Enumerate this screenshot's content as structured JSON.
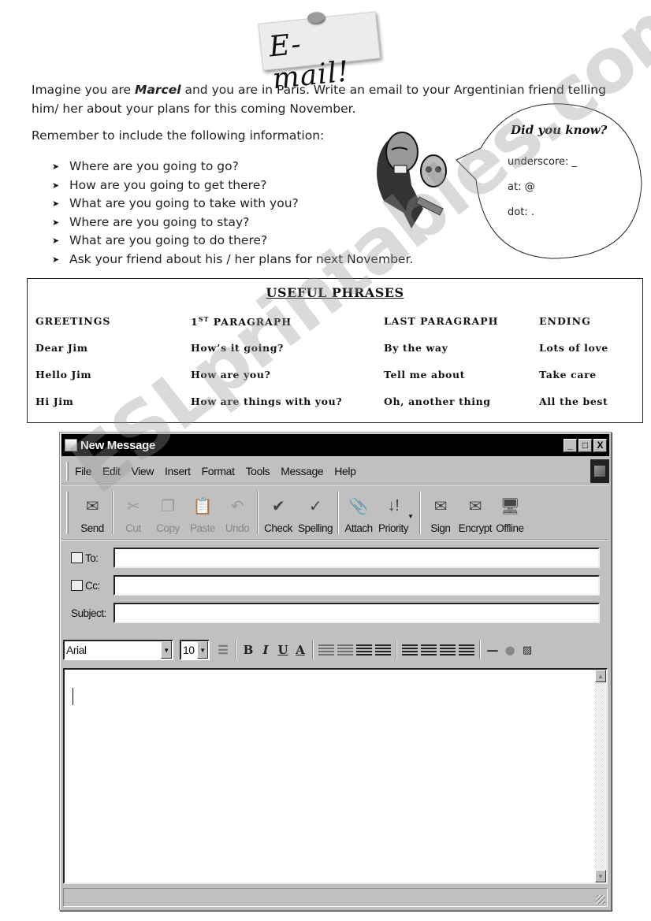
{
  "header": {
    "title": "E-mail!"
  },
  "intro": {
    "pre": "Imagine you are ",
    "name": "Marcel",
    "post": " and you are in Paris. Write an email to your Argentinian friend telling him/ her about your plans for this coming November.",
    "remember": "Remember to include the following information:"
  },
  "checklist": [
    "Where are you going to go?",
    "How are you going to get there?",
    "What are you going to take with you?",
    "Where are you going to stay?",
    "What are you going to do there?",
    "Ask your friend about his / her plans for next November."
  ],
  "bubble": {
    "title": "Did you know?",
    "items": [
      "underscore:  _",
      "at:  @",
      "dot:  ."
    ]
  },
  "phrases": {
    "title": "USEFUL PHRASES",
    "columns": [
      {
        "header": "GREETINGS",
        "items": [
          "Dear Jim",
          "Hello Jim",
          "Hi Jim"
        ]
      },
      {
        "header_num": "1",
        "header_sup": "ST",
        "header_rest": " PARAGRAPH",
        "items": [
          "How’s it going?",
          "How are you?",
          "How are things with you?"
        ]
      },
      {
        "header": "LAST PARAGRAPH",
        "items": [
          "By the way",
          "Tell me about",
          "Oh, another thing"
        ]
      },
      {
        "header": "ENDING",
        "items": [
          "Lots of love",
          "Take care",
          "All the best"
        ]
      }
    ]
  },
  "window": {
    "title": "New Message",
    "controls": {
      "minimize": "_",
      "maximize": "□",
      "close": "X"
    },
    "menu": [
      "File",
      "Edit",
      "View",
      "Insert",
      "Format",
      "Tools",
      "Message",
      "Help"
    ],
    "toolbar": [
      {
        "label": "Send",
        "icon": "send-icon",
        "glyph": "✉",
        "enabled": true
      },
      {
        "label": "Cut",
        "icon": "scissors-icon",
        "glyph": "✂",
        "enabled": false
      },
      {
        "label": "Copy",
        "icon": "copy-icon",
        "glyph": "❐",
        "enabled": false
      },
      {
        "label": "Paste",
        "icon": "paste-icon",
        "glyph": "📋",
        "enabled": false
      },
      {
        "label": "Undo",
        "icon": "undo-icon",
        "glyph": "↶",
        "enabled": false
      },
      {
        "label": "Check",
        "icon": "check-names-icon",
        "glyph": "✔",
        "enabled": true
      },
      {
        "label": "Spelling",
        "icon": "spelling-icon",
        "glyph": "✓",
        "enabled": true
      },
      {
        "label": "Attach",
        "icon": "paperclip-icon",
        "glyph": "📎",
        "enabled": true
      },
      {
        "label": "Priority",
        "icon": "priority-icon",
        "glyph": "↓!",
        "enabled": true
      },
      {
        "label": "Sign",
        "icon": "sign-icon",
        "glyph": "✉",
        "enabled": true
      },
      {
        "label": "Encrypt",
        "icon": "encrypt-icon",
        "glyph": "✉",
        "enabled": true
      },
      {
        "label": "Offline",
        "icon": "offline-icon",
        "glyph": "🖥",
        "enabled": true
      }
    ],
    "fields": {
      "to_label": "To:",
      "to_value": "",
      "cc_label": "Cc:",
      "cc_value": "",
      "subject_label": "Subject:",
      "subject_value": ""
    },
    "format": {
      "font": "Arial",
      "size": "10",
      "bold": "B",
      "italic": "I",
      "underline": "U",
      "color": "A"
    },
    "body_text": ""
  },
  "watermark": "ESLprintables.com"
}
